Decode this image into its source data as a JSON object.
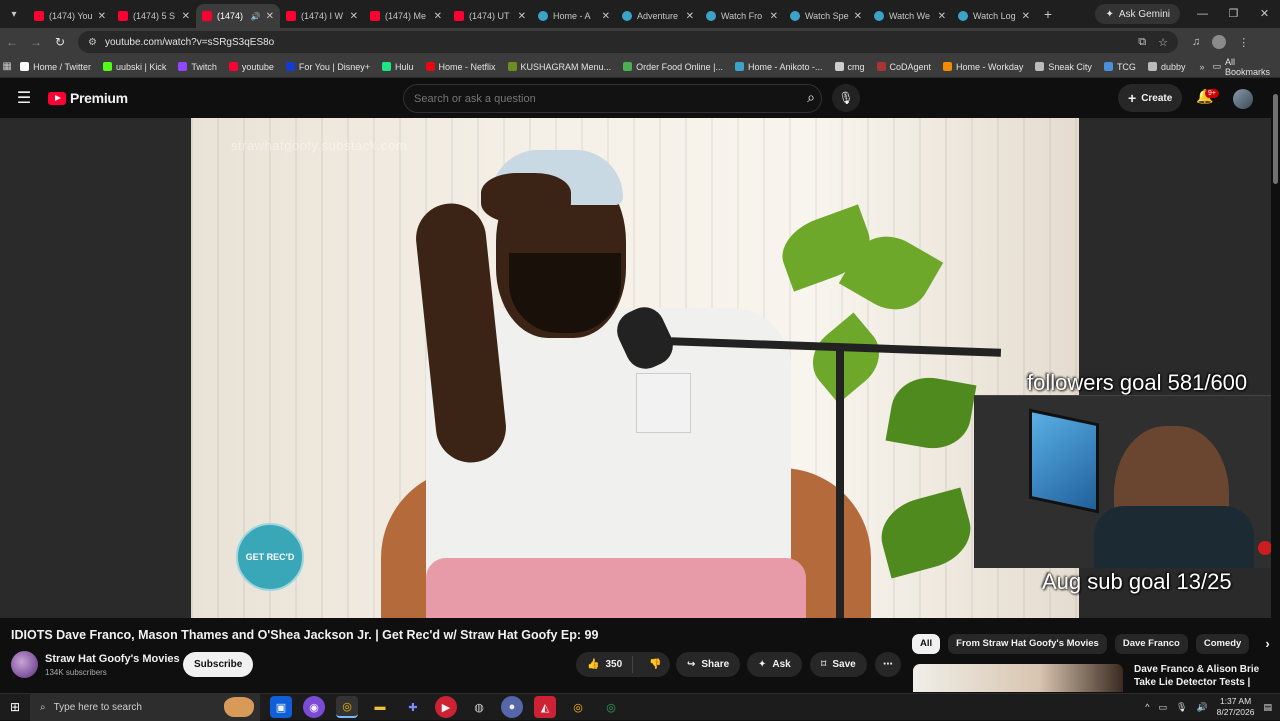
{
  "browser": {
    "tabs": [
      {
        "label": "(1474) You",
        "icon": "youtube-icon"
      },
      {
        "label": "(1474) 5 S",
        "icon": "youtube-icon"
      },
      {
        "label": "(1474)",
        "icon": "youtube-icon",
        "active": true
      },
      {
        "label": "(1474) I W",
        "icon": "youtube-icon"
      },
      {
        "label": "(1474) Me",
        "icon": "youtube-icon"
      },
      {
        "label": "(1474) UT",
        "icon": "youtube-icon"
      },
      {
        "label": "Home - A",
        "icon": "globe-icon"
      },
      {
        "label": "Adventure",
        "icon": "globe-icon"
      },
      {
        "label": "Watch Fro",
        "icon": "globe-icon"
      },
      {
        "label": "Watch Spe",
        "icon": "globe-icon"
      },
      {
        "label": "Watch We",
        "icon": "globe-icon"
      },
      {
        "label": "Watch Log",
        "icon": "globe-icon"
      }
    ],
    "ask_gemini": "Ask Gemini",
    "url": "youtube.com/watch?v=sSRgS3qES8o",
    "bookmarks": [
      {
        "label": "Home / Twitter",
        "color": "#ffffff"
      },
      {
        "label": "uubski | Kick",
        "color": "#53fc18"
      },
      {
        "label": "Twitch",
        "color": "#9146ff"
      },
      {
        "label": "youtube",
        "color": "#ff0033"
      },
      {
        "label": "For You | Disney+",
        "color": "#113ccf"
      },
      {
        "label": "Hulu",
        "color": "#1ce783"
      },
      {
        "label": "Home - Netflix",
        "color": "#e50914"
      },
      {
        "label": "KUSHAGRAM Menu...",
        "color": "#6b8e23"
      },
      {
        "label": "Order Food Online |...",
        "color": "#4caf50"
      },
      {
        "label": "Home - Anikoto -...",
        "color": "#3aa3c7"
      },
      {
        "label": "cmg",
        "color": "#cccccc"
      },
      {
        "label": "CoDAgent",
        "color": "#a33"
      },
      {
        "label": "Home - Workday",
        "color": "#f38b00"
      },
      {
        "label": "Sneak City",
        "color": "#bbbbbb"
      },
      {
        "label": "TCG",
        "color": "#4a90d9"
      },
      {
        "label": "dubby",
        "color": "#bbbbbb"
      }
    ],
    "all_bookmarks": "All Bookmarks"
  },
  "youtube": {
    "logo_text": "Premium",
    "search_placeholder": "Search or ask a question",
    "create_label": "Create",
    "notification_badge": "9+"
  },
  "video": {
    "watermark": "strawhatgoofy.substack.com",
    "badge_text": "GET REC'D",
    "overlay_followers": "followers goal 581/600",
    "overlay_subs": "Aug sub goal 13/25",
    "title": "IDIOTS Dave Franco, Mason Thames and O'Shea Jackson Jr. | Get Rec'd w/ Straw Hat Goofy Ep: 99",
    "channel_name": "Straw Hat Goofy's Movies",
    "subscribers": "134K subscribers",
    "subscribe_label": "Subscribe",
    "like_count": "350",
    "share_label": "Share",
    "ask_label": "Ask",
    "save_label": "Save"
  },
  "sidebar": {
    "chips": [
      "All",
      "From Straw Hat Goofy's Movies",
      "Dave Franco",
      "Comedy"
    ],
    "next_title": "Dave Franco & Alison Brie Take Lie Detector Tests |"
  },
  "taskbar": {
    "search_placeholder": "Type here to search",
    "time": "1:37 AM",
    "date": "8/27/2026"
  }
}
